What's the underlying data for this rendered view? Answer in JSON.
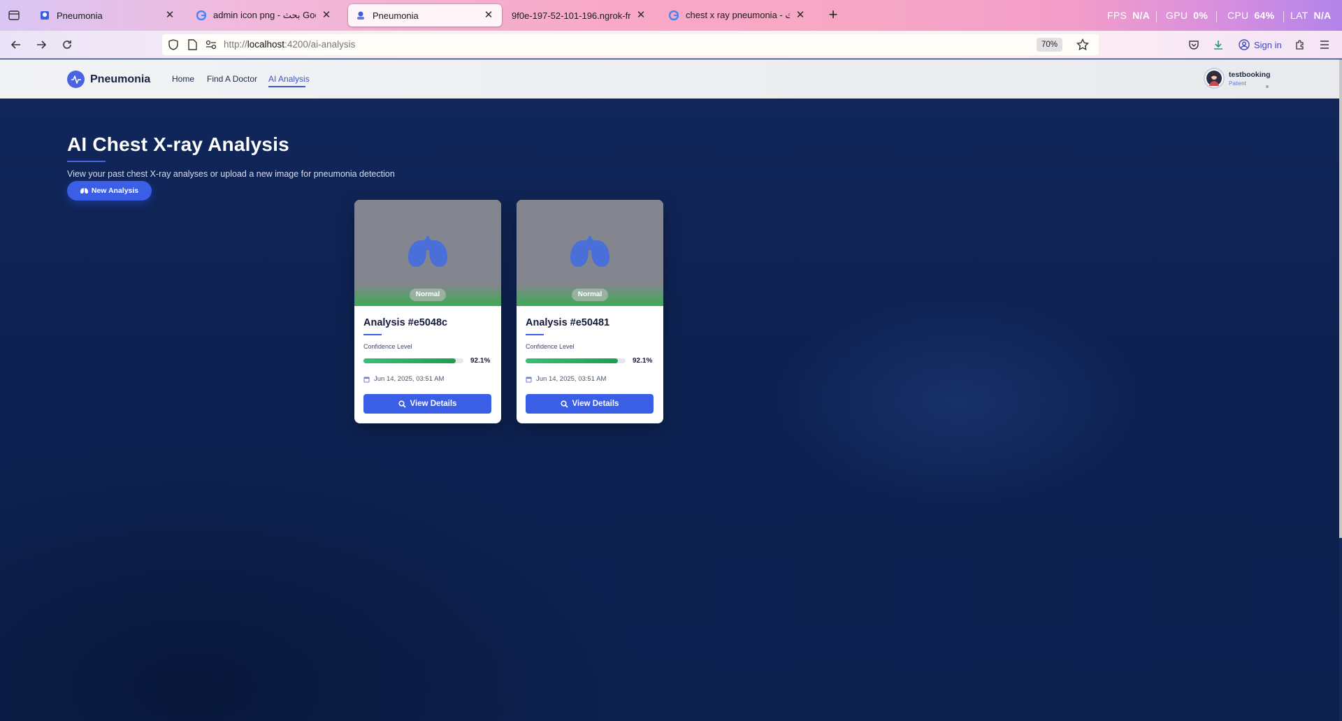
{
  "browser": {
    "tabs": [
      {
        "title": "Pneumonia",
        "icon": "pneumonia-favicon",
        "active": false
      },
      {
        "title": "admin icon png - بحث Google",
        "icon": "google-icon",
        "active": false
      },
      {
        "title": "Pneumonia",
        "icon": "pneumonia-favicon",
        "active": true
      },
      {
        "title": "9f0e-197-52-101-196.ngrok-free.app",
        "icon": "none",
        "active": false
      },
      {
        "title": "chest x ray pneumonia - بحث Google",
        "icon": "google-icon",
        "active": false
      }
    ],
    "url_scheme": "http://",
    "url_host": "localhost",
    "url_path": ":4200/ai-analysis",
    "zoom": "70%",
    "signin_label": "Sign in",
    "perf": {
      "fps_label": "FPS",
      "fps_value": "N/A",
      "gpu_label": "GPU",
      "gpu_value": "0%",
      "cpu_label": "CPU",
      "cpu_value": "64%",
      "lat_label": "LAT",
      "lat_value": "N/A"
    }
  },
  "app": {
    "brand": "Pneumonia",
    "nav": [
      "Home",
      "Find A Doctor",
      "AI Analysis"
    ],
    "active_nav": "AI Analysis",
    "user": {
      "name": "testbooking",
      "role": "Patient"
    }
  },
  "main": {
    "title": "AI Chest X-ray Analysis",
    "subtitle": "View your past chest X-ray analyses or upload a new image for pneumonia detection",
    "new_analysis_label": "New Analysis"
  },
  "analyses": [
    {
      "badge": "Normal",
      "title": "Analysis #e5048c",
      "confidence_label": "Confidence Level",
      "confidence": 92.1,
      "confidence_text": "92.1%",
      "date": "Jun 14, 2025, 03:51 AM",
      "button_label": "View Details"
    },
    {
      "badge": "Normal",
      "title": "Analysis #e50481",
      "confidence_label": "Confidence Level",
      "confidence": 92.1,
      "confidence_text": "92.1%",
      "date": "Jun 14, 2025, 03:51 AM",
      "button_label": "View Details"
    }
  ],
  "colors": {
    "accent": "#3b5ee6",
    "success": "#2aa85e",
    "page_bg": "#0e2250"
  }
}
